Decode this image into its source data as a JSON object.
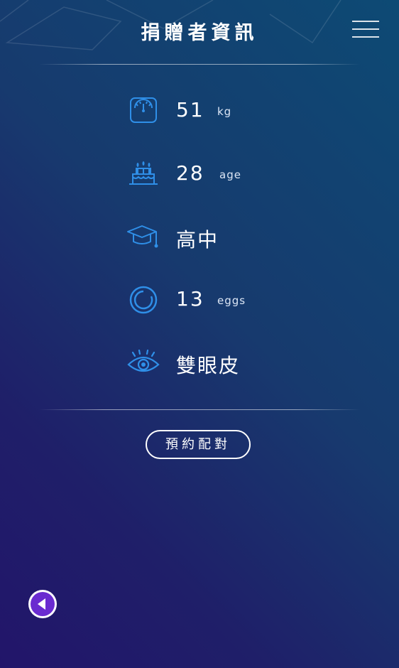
{
  "header": {
    "title": "捐贈者資訊",
    "menu_icon": "hamburger-menu-icon"
  },
  "donor": [
    {
      "icon": "weight-scale-icon",
      "value": "51",
      "unit": "kg"
    },
    {
      "icon": "birthday-cake-icon",
      "value": "28",
      "unit": "age"
    },
    {
      "icon": "graduation-cap-icon",
      "value": "高中",
      "unit": ""
    },
    {
      "icon": "egg-ring-icon",
      "value": "13",
      "unit": "eggs"
    },
    {
      "icon": "eye-icon",
      "value": "雙眼皮",
      "unit": ""
    }
  ],
  "actions": {
    "match_label": "預約配對",
    "back_icon": "back-arrow-icon"
  },
  "colors": {
    "accent_blue": "#2f8fe8",
    "back_purple": "#6a2bd0",
    "text": "#ffffff"
  }
}
